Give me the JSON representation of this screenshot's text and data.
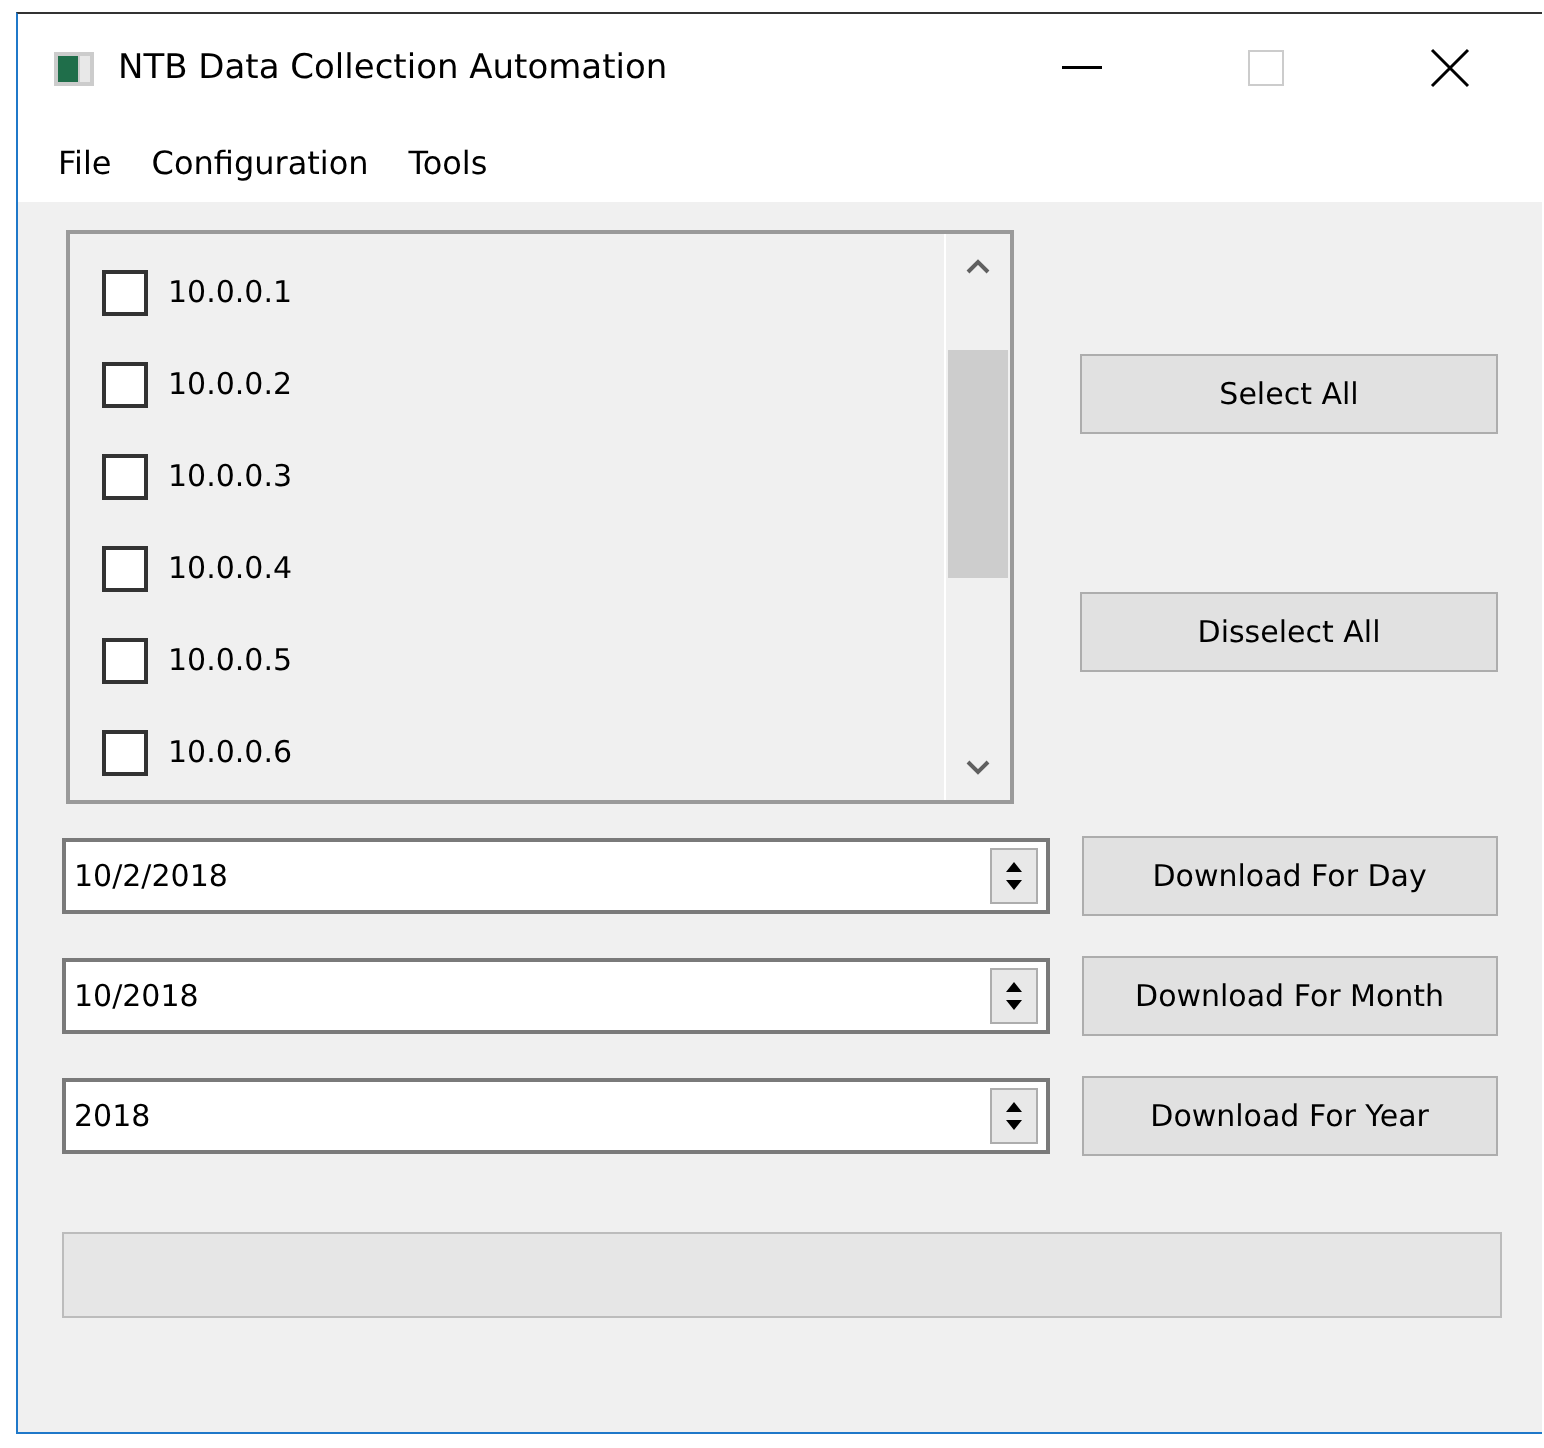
{
  "window": {
    "title": "NTB Data Collection Automation"
  },
  "menu": [
    "File",
    "Configuration",
    "Tools"
  ],
  "hosts": [
    {
      "label": "10.0.0.1",
      "checked": false
    },
    {
      "label": "10.0.0.2",
      "checked": false
    },
    {
      "label": "10.0.0.3",
      "checked": false
    },
    {
      "label": "10.0.0.4",
      "checked": false
    },
    {
      "label": "10.0.0.5",
      "checked": false
    },
    {
      "label": "10.0.0.6",
      "checked": false
    }
  ],
  "selection_buttons": [
    "Select All",
    "Disselect All"
  ],
  "downloads": [
    {
      "value": "10/2/2018",
      "button": "Download For Day"
    },
    {
      "value": "10/2018",
      "button": "Download For Month"
    },
    {
      "value": "2018",
      "button": "Download For Year"
    }
  ]
}
